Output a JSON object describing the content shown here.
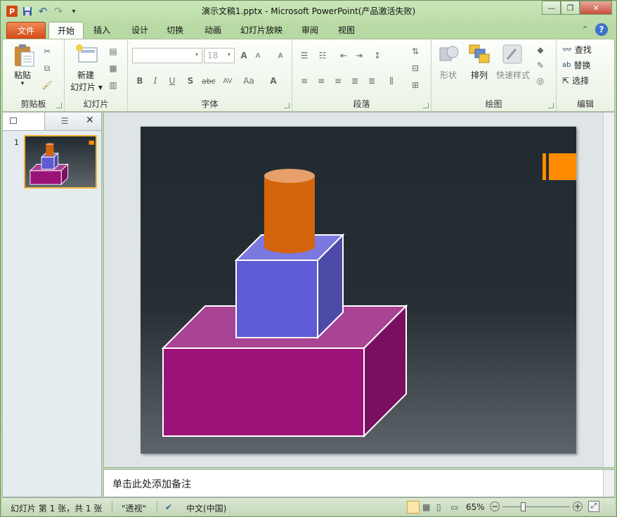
{
  "window": {
    "title": "演示文稿1.pptx - Microsoft PowerPoint(产品激活失败)",
    "minimize_label": "—",
    "maximize_label": "❐",
    "close_label": "✕"
  },
  "qat": {
    "app_icon": "P",
    "undo_icon": "↶",
    "redo_icon": "↷",
    "customize_icon": "▾"
  },
  "tabs": [
    {
      "label": "文件"
    },
    {
      "label": "开始"
    },
    {
      "label": "插入"
    },
    {
      "label": "设计"
    },
    {
      "label": "切换"
    },
    {
      "label": "动画"
    },
    {
      "label": "幻灯片放映"
    },
    {
      "label": "审阅"
    },
    {
      "label": "视图"
    }
  ],
  "ribbon": {
    "clipboard": {
      "label": "剪贴板",
      "paste": "粘贴",
      "paste_arrow": "▾"
    },
    "slides": {
      "label": "幻灯片",
      "new_slide_line1": "新建",
      "new_slide_line2": "幻灯片 ▾"
    },
    "font": {
      "label": "字体",
      "font_name": "",
      "font_size": "18",
      "grow": "A",
      "shrink": "A",
      "bold": "B",
      "italic": "I",
      "underline": "U",
      "shadow": "S",
      "strike": "abc",
      "spacing": "AV",
      "case": "Aa",
      "color": "A"
    },
    "paragraph": {
      "label": "段落"
    },
    "drawing": {
      "label": "绘图",
      "shapes": "形状",
      "arrange": "排列",
      "quick_styles": "快速样式"
    },
    "editing": {
      "label": "编辑",
      "find": "查找",
      "replace": "替换",
      "select": "选择"
    }
  },
  "left_pane": {
    "slide_number": "1",
    "close": "✕"
  },
  "notes": {
    "placeholder": "单击此处添加备注"
  },
  "status": {
    "slide_info": "幻灯片 第 1 张，共 1 张",
    "theme": "\"透视\"",
    "language": "中文(中国)",
    "zoom": "65%",
    "zoom_out": "−",
    "zoom_in": "+"
  },
  "colors": {
    "cylinder": "#d4640b",
    "cube": "#5f5bd4",
    "box_front": "#9b1278",
    "accent": "#ff8c00",
    "file_tab": "#d24a17"
  }
}
